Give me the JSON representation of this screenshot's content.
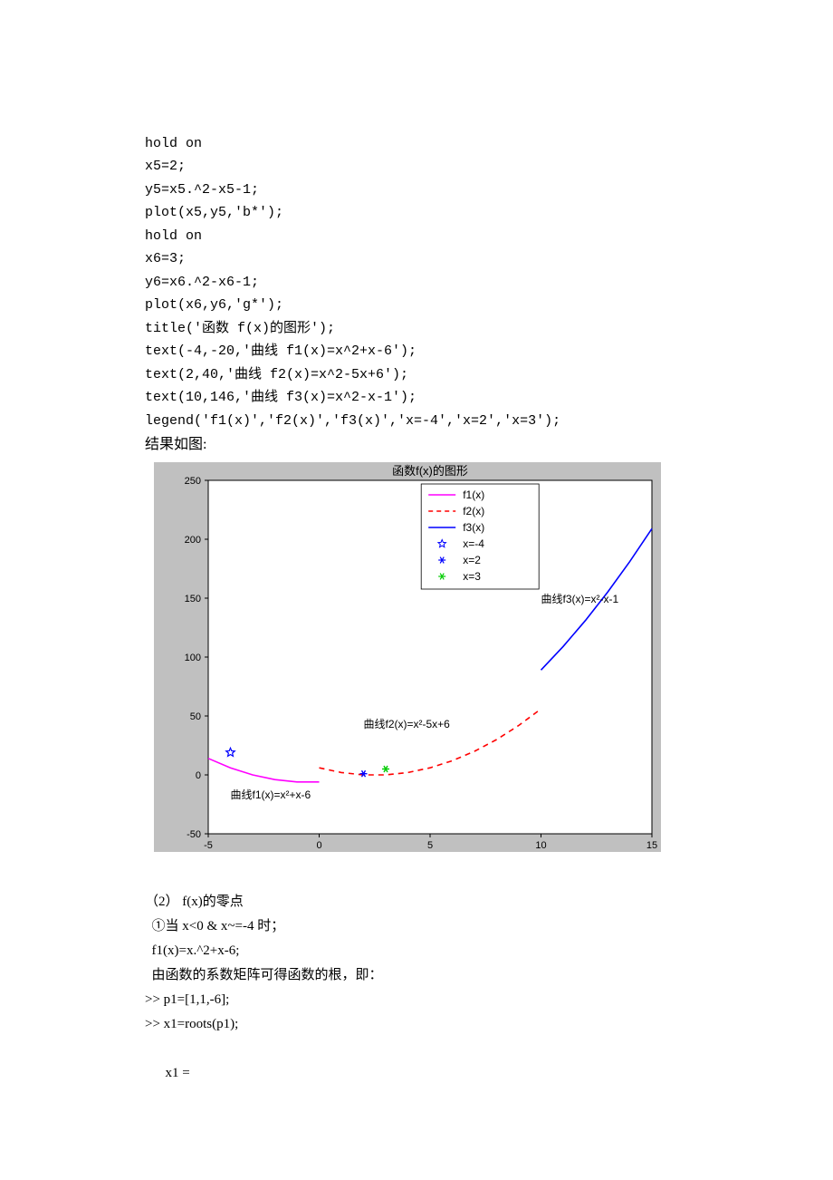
{
  "code": {
    "l1": "hold on",
    "l2": "x5=2;",
    "l3": "y5=x5.^2-x5-1;",
    "l4": "plot(x5,y5,'b*');",
    "l5": "hold on",
    "l6": "x6=3;",
    "l7": "y6=x6.^2-x6-1;",
    "l8": "plot(x6,y6,'g*');",
    "l9": "title('函数 f(x)的图形');",
    "l10": "text(-4,-20,'曲线 f1(x)=x^2+x-6');",
    "l11": "text(2,40,'曲线 f2(x)=x^2-5x+6');",
    "l12": "text(10,146,'曲线 f3(x)=x^2-x-1');",
    "l13": "legend('f1(x)','f2(x)','f3(x)','x=-4','x=2','x=3');"
  },
  "result_label": "结果如图:",
  "chart_data": {
    "type": "line",
    "title": "函数f(x)的图形",
    "xlabel": "",
    "ylabel": "",
    "xlim": [
      -5,
      15
    ],
    "ylim": [
      -50,
      250
    ],
    "xticks": [
      -5,
      0,
      5,
      10,
      15
    ],
    "yticks": [
      -50,
      0,
      50,
      100,
      150,
      200,
      250
    ],
    "series": [
      {
        "name": "f1(x)",
        "style": "solid",
        "color": "#ff00ff",
        "x": [
          -5,
          -4,
          -3,
          -2,
          -1,
          0
        ],
        "y": [
          14,
          6,
          0,
          -4,
          -6,
          -6
        ]
      },
      {
        "name": "f2(x)",
        "style": "dashed",
        "color": "#ff0000",
        "x": [
          0,
          1,
          2,
          3,
          4,
          5,
          6,
          7,
          8,
          9,
          10
        ],
        "y": [
          6,
          2,
          0,
          0,
          2,
          6,
          12,
          20,
          30,
          42,
          56
        ]
      },
      {
        "name": "f3(x)",
        "style": "solid",
        "color": "#0000ff",
        "x": [
          10,
          11,
          12,
          13,
          14,
          15
        ],
        "y": [
          89,
          109,
          131,
          155,
          181,
          209
        ]
      },
      {
        "name": "x=-4",
        "style": "marker-star-open",
        "color": "#0000ff",
        "x": [
          -4
        ],
        "y": [
          19
        ]
      },
      {
        "name": "x=2",
        "style": "marker-asterisk",
        "color": "#0000ff",
        "x": [
          2
        ],
        "y": [
          1
        ]
      },
      {
        "name": "x=3",
        "style": "marker-asterisk",
        "color": "#00cc00",
        "x": [
          3
        ],
        "y": [
          5
        ]
      }
    ],
    "annotations": [
      {
        "text": "曲线f1(x)=x^2+x-6",
        "x": -4,
        "y": -20
      },
      {
        "text": "曲线f2(x)=x^2-5x+6",
        "x": 2,
        "y": 40
      },
      {
        "text": "曲线f3(x)=x^2-x-1",
        "x": 10,
        "y": 146
      }
    ],
    "legend_position": "top-center"
  },
  "post": {
    "l1": "（2） f(x)的零点",
    "l2": "  ①当 x<0 & x~=-4 时；",
    "l3": "  f1(x)=x.^2+x-6;",
    "l4": "  由函数的系数矩阵可得函数的根，即：",
    "l5": ">> p1=[1,1,-6];",
    "l6": ">> x1=roots(p1);",
    "l7": "",
    "l8": "      x1 ="
  }
}
